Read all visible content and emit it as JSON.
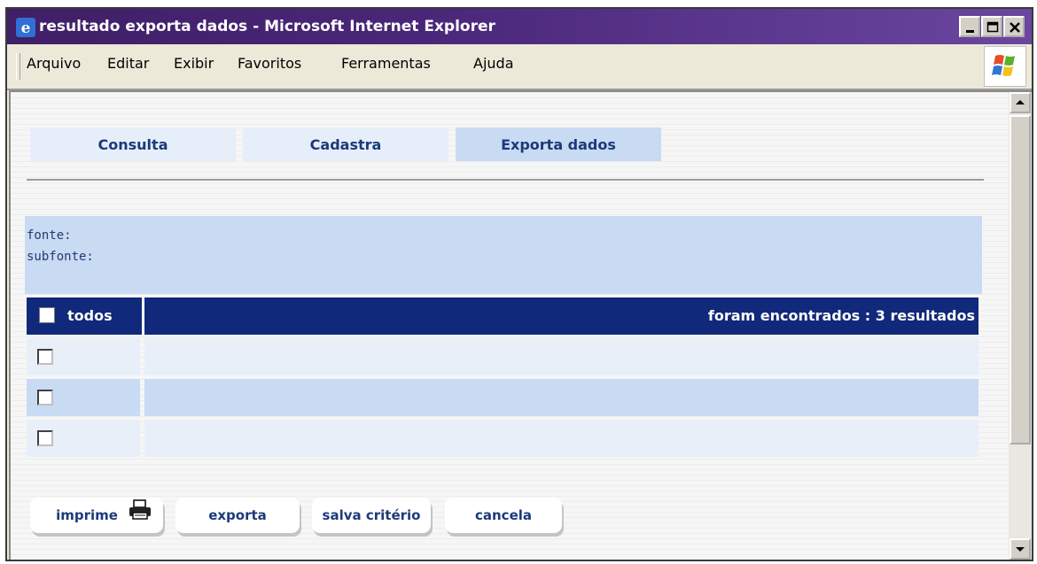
{
  "window": {
    "title": "resultado exporta dados - Microsoft Internet Explorer",
    "icon": "ie-icon",
    "controls": [
      "minimize-icon",
      "maximize-icon",
      "close-icon"
    ]
  },
  "menu": {
    "items": [
      {
        "label": "Arquivo"
      },
      {
        "label": "Editar"
      },
      {
        "label": "Exibir"
      },
      {
        "label": "Favoritos"
      },
      {
        "label": "Ferramentas"
      },
      {
        "label": "Ajuda"
      }
    ]
  },
  "tabs": [
    {
      "label": "Consulta",
      "active": false
    },
    {
      "label": "Cadastra",
      "active": false
    },
    {
      "label": "Exporta dados",
      "active": true
    }
  ],
  "filters": {
    "fonte_label": "fonte:",
    "subfonte_label": "subfonte:"
  },
  "table": {
    "select_all_label": "todos",
    "results_text": "foram encontrados : 3 resultados",
    "rows": [
      {
        "checked": false
      },
      {
        "checked": false
      },
      {
        "checked": false
      }
    ]
  },
  "actions": {
    "print": "imprime",
    "export": "exporta",
    "save": "salva critério",
    "cancel": "cancela"
  },
  "colors": {
    "title_bar": "#4a2679",
    "header_bg": "#11297a",
    "tab_bg": "#e6eef9",
    "tab_active_bg": "#c9daf3",
    "link_text": "#1c3a7a"
  }
}
